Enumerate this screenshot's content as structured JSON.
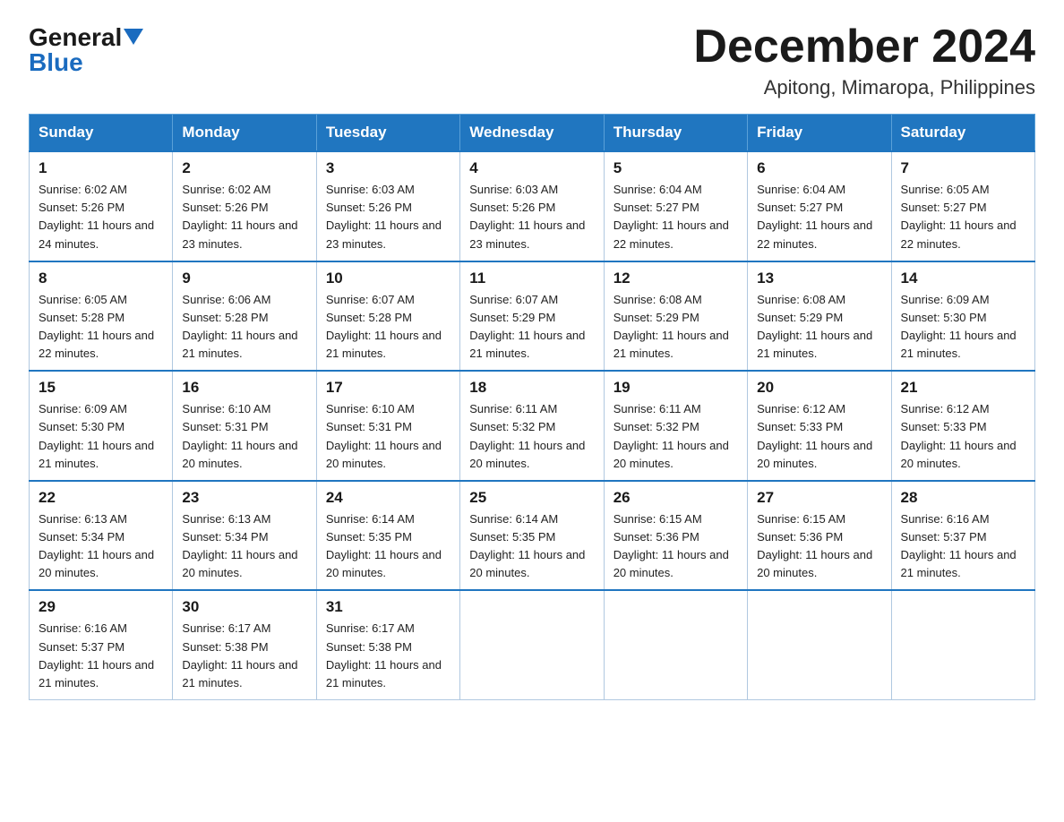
{
  "logo": {
    "general": "General",
    "blue": "Blue"
  },
  "title": "December 2024",
  "location": "Apitong, Mimaropa, Philippines",
  "days_of_week": [
    "Sunday",
    "Monday",
    "Tuesday",
    "Wednesday",
    "Thursday",
    "Friday",
    "Saturday"
  ],
  "weeks": [
    [
      {
        "day": "1",
        "sunrise": "6:02 AM",
        "sunset": "5:26 PM",
        "daylight": "11 hours and 24 minutes."
      },
      {
        "day": "2",
        "sunrise": "6:02 AM",
        "sunset": "5:26 PM",
        "daylight": "11 hours and 23 minutes."
      },
      {
        "day": "3",
        "sunrise": "6:03 AM",
        "sunset": "5:26 PM",
        "daylight": "11 hours and 23 minutes."
      },
      {
        "day": "4",
        "sunrise": "6:03 AM",
        "sunset": "5:26 PM",
        "daylight": "11 hours and 23 minutes."
      },
      {
        "day": "5",
        "sunrise": "6:04 AM",
        "sunset": "5:27 PM",
        "daylight": "11 hours and 22 minutes."
      },
      {
        "day": "6",
        "sunrise": "6:04 AM",
        "sunset": "5:27 PM",
        "daylight": "11 hours and 22 minutes."
      },
      {
        "day": "7",
        "sunrise": "6:05 AM",
        "sunset": "5:27 PM",
        "daylight": "11 hours and 22 minutes."
      }
    ],
    [
      {
        "day": "8",
        "sunrise": "6:05 AM",
        "sunset": "5:28 PM",
        "daylight": "11 hours and 22 minutes."
      },
      {
        "day": "9",
        "sunrise": "6:06 AM",
        "sunset": "5:28 PM",
        "daylight": "11 hours and 21 minutes."
      },
      {
        "day": "10",
        "sunrise": "6:07 AM",
        "sunset": "5:28 PM",
        "daylight": "11 hours and 21 minutes."
      },
      {
        "day": "11",
        "sunrise": "6:07 AM",
        "sunset": "5:29 PM",
        "daylight": "11 hours and 21 minutes."
      },
      {
        "day": "12",
        "sunrise": "6:08 AM",
        "sunset": "5:29 PM",
        "daylight": "11 hours and 21 minutes."
      },
      {
        "day": "13",
        "sunrise": "6:08 AM",
        "sunset": "5:29 PM",
        "daylight": "11 hours and 21 minutes."
      },
      {
        "day": "14",
        "sunrise": "6:09 AM",
        "sunset": "5:30 PM",
        "daylight": "11 hours and 21 minutes."
      }
    ],
    [
      {
        "day": "15",
        "sunrise": "6:09 AM",
        "sunset": "5:30 PM",
        "daylight": "11 hours and 21 minutes."
      },
      {
        "day": "16",
        "sunrise": "6:10 AM",
        "sunset": "5:31 PM",
        "daylight": "11 hours and 20 minutes."
      },
      {
        "day": "17",
        "sunrise": "6:10 AM",
        "sunset": "5:31 PM",
        "daylight": "11 hours and 20 minutes."
      },
      {
        "day": "18",
        "sunrise": "6:11 AM",
        "sunset": "5:32 PM",
        "daylight": "11 hours and 20 minutes."
      },
      {
        "day": "19",
        "sunrise": "6:11 AM",
        "sunset": "5:32 PM",
        "daylight": "11 hours and 20 minutes."
      },
      {
        "day": "20",
        "sunrise": "6:12 AM",
        "sunset": "5:33 PM",
        "daylight": "11 hours and 20 minutes."
      },
      {
        "day": "21",
        "sunrise": "6:12 AM",
        "sunset": "5:33 PM",
        "daylight": "11 hours and 20 minutes."
      }
    ],
    [
      {
        "day": "22",
        "sunrise": "6:13 AM",
        "sunset": "5:34 PM",
        "daylight": "11 hours and 20 minutes."
      },
      {
        "day": "23",
        "sunrise": "6:13 AM",
        "sunset": "5:34 PM",
        "daylight": "11 hours and 20 minutes."
      },
      {
        "day": "24",
        "sunrise": "6:14 AM",
        "sunset": "5:35 PM",
        "daylight": "11 hours and 20 minutes."
      },
      {
        "day": "25",
        "sunrise": "6:14 AM",
        "sunset": "5:35 PM",
        "daylight": "11 hours and 20 minutes."
      },
      {
        "day": "26",
        "sunrise": "6:15 AM",
        "sunset": "5:36 PM",
        "daylight": "11 hours and 20 minutes."
      },
      {
        "day": "27",
        "sunrise": "6:15 AM",
        "sunset": "5:36 PM",
        "daylight": "11 hours and 20 minutes."
      },
      {
        "day": "28",
        "sunrise": "6:16 AM",
        "sunset": "5:37 PM",
        "daylight": "11 hours and 21 minutes."
      }
    ],
    [
      {
        "day": "29",
        "sunrise": "6:16 AM",
        "sunset": "5:37 PM",
        "daylight": "11 hours and 21 minutes."
      },
      {
        "day": "30",
        "sunrise": "6:17 AM",
        "sunset": "5:38 PM",
        "daylight": "11 hours and 21 minutes."
      },
      {
        "day": "31",
        "sunrise": "6:17 AM",
        "sunset": "5:38 PM",
        "daylight": "11 hours and 21 minutes."
      },
      null,
      null,
      null,
      null
    ]
  ]
}
